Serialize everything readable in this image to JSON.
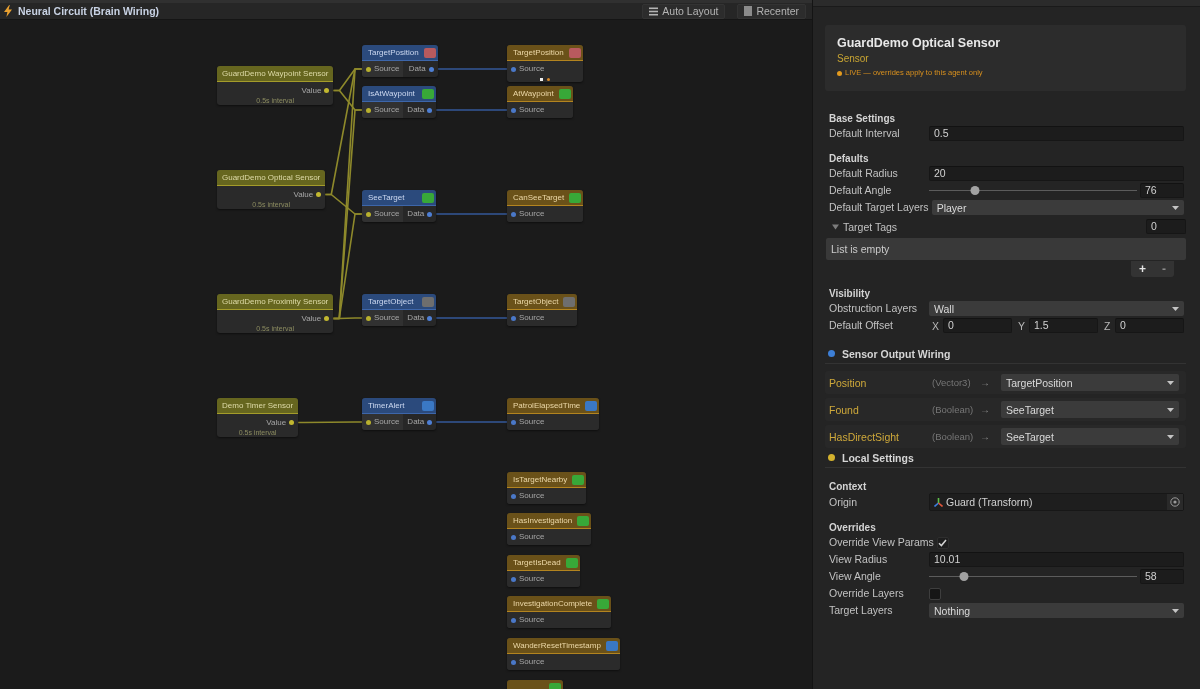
{
  "graph_panel": {
    "title": "Neural Circuit (Brain Wiring)",
    "toolbar": [
      {
        "label": "Auto Layout"
      },
      {
        "label": "Recenter"
      }
    ]
  },
  "graph": {
    "nodes": [
      {
        "kind": "sensor",
        "title": "GuardDemo Waypoint Sensor",
        "outputs": [
          "Value"
        ],
        "note": "0.5s interval"
      },
      {
        "kind": "sensor",
        "title": "GuardDemo Optical Sensor",
        "outputs": [
          "Value"
        ],
        "note": "0.5s interval"
      },
      {
        "kind": "sensor",
        "title": "GuardDemo Proximity Sensor",
        "outputs": [
          "Value"
        ],
        "note": "0.5s interval"
      },
      {
        "kind": "sensor",
        "title": "Demo Timer Sensor",
        "outputs": [
          "Value"
        ],
        "note": "0.5s interval"
      },
      {
        "kind": "data",
        "title": "TargetPosition",
        "badge": {
          "color": "#b85a5e"
        },
        "inputs": [
          "Source"
        ],
        "outputs": [
          "Data"
        ]
      },
      {
        "kind": "data",
        "title": "IsAtWaypoint",
        "badge": {
          "color": "#38a838"
        },
        "inputs": [
          "Source"
        ],
        "outputs": [
          "Data"
        ]
      },
      {
        "kind": "data",
        "title": "SeeTarget",
        "badge": {
          "color": "#38a838"
        },
        "inputs": [
          "Source"
        ],
        "outputs": [
          "Data"
        ]
      },
      {
        "kind": "data",
        "title": "TargetObject",
        "badge": {
          "color": "#6e6e6e"
        },
        "inputs": [
          "Source"
        ],
        "outputs": [
          "Data"
        ]
      },
      {
        "kind": "data",
        "title": "TimerAlert",
        "badge": {
          "color": "#3a78c4"
        },
        "inputs": [
          "Source"
        ],
        "outputs": [
          "Data"
        ]
      },
      {
        "kind": "target",
        "title": "TargetPosition",
        "badge": {
          "color": "#b85a5e"
        },
        "inputs": [
          "Source"
        ],
        "indicators": true
      },
      {
        "kind": "target",
        "title": "AtWaypoint",
        "badge": {
          "color": "#38a838"
        },
        "inputs": [
          "Source"
        ],
        "indicators": false
      },
      {
        "kind": "target",
        "title": "CanSeeTarget",
        "badge": {
          "color": "#38a838"
        },
        "inputs": [
          "Source"
        ],
        "indicators": false
      },
      {
        "kind": "target",
        "title": "TargetObject",
        "badge": {
          "color": "#6e6e6e"
        },
        "inputs": [
          "Source"
        ],
        "indicators": false
      },
      {
        "kind": "target",
        "title": "PatrolElapsedTime",
        "badge": {
          "color": "#3a78c4"
        },
        "inputs": [
          "Source"
        ],
        "indicators": false
      },
      {
        "kind": "target",
        "title": "IsTargetNearby",
        "badge": {
          "color": "#38a838"
        },
        "inputs": [
          "Source"
        ],
        "indicators": false
      },
      {
        "kind": "target",
        "title": "HasInvestigation",
        "badge": {
          "color": "#38a838"
        },
        "inputs": [
          "Source"
        ],
        "indicators": false
      },
      {
        "kind": "target",
        "title": "TargetIsDead",
        "badge": {
          "color": "#38a838"
        },
        "inputs": [
          "Source"
        ],
        "indicators": false
      },
      {
        "kind": "target",
        "title": "InvestigationComplete",
        "badge": {
          "color": "#38a838"
        },
        "inputs": [
          "Source"
        ],
        "indicators": false
      },
      {
        "kind": "target",
        "title": "WanderResetTimestamp",
        "badge": {
          "color": "#3a78c4"
        },
        "inputs": [
          "Source"
        ],
        "indicators": false
      },
      {
        "kind": "target",
        "badge": {
          "color": "#38a838"
        },
        "indicators": false
      }
    ]
  },
  "inspector": {
    "header": {
      "title": "GuardDemo Optical Sensor",
      "subtitle": "Sensor",
      "status": "LIVE — overrides apply to this agent only"
    },
    "sections": [
      {
        "kind": "group",
        "title": "Base Settings",
        "fields": [
          {
            "kind": "number",
            "label": "Default Interval",
            "value": "0.5"
          }
        ]
      },
      {
        "kind": "group",
        "title": "Defaults",
        "fields": [
          {
            "kind": "number",
            "label": "Default Radius",
            "value": "20"
          },
          {
            "kind": "slider",
            "label": "Default Angle",
            "level": 0.22,
            "value": "76"
          },
          {
            "kind": "dropdown",
            "label": "Default Target Layers",
            "value": "Player"
          },
          {
            "kind": "list",
            "label": "Target Tags",
            "expanded": true,
            "count": "0",
            "empty_text": "List is empty",
            "buttons": [
              "+",
              "-"
            ]
          }
        ]
      },
      {
        "kind": "group",
        "title": "Visibility",
        "fields": [
          {
            "kind": "dropdown",
            "label": "Obstruction Layers",
            "value": "Wall"
          },
          {
            "kind": "vector",
            "label": "Default Offset",
            "components": [
              {
                "axis": "X",
                "value": "0"
              },
              {
                "axis": "Y",
                "value": "1.5"
              },
              {
                "axis": "Z",
                "value": "0"
              }
            ]
          }
        ]
      },
      {
        "kind": "heading",
        "title": "Sensor Output Wiring",
        "color": "#3d7fd6"
      },
      {
        "kind": "wiring",
        "rows": [
          {
            "port": "Position",
            "type": "(Vector3)",
            "arrow": "→",
            "target": "TargetPosition"
          },
          {
            "port": "Found",
            "type": "(Boolean)",
            "arrow": "→",
            "target": "SeeTarget"
          },
          {
            "port": "HasDirectSight",
            "type": "(Boolean)",
            "arrow": "→",
            "target": "SeeTarget"
          }
        ]
      },
      {
        "kind": "heading",
        "title": "Local Settings",
        "color": "#d4b22e"
      },
      {
        "kind": "group",
        "title": "Context",
        "fields": [
          {
            "kind": "object",
            "label": "Origin",
            "value": "Guard (Transform)"
          }
        ]
      },
      {
        "kind": "group",
        "title": "Overrides",
        "fields": [
          {
            "kind": "checkbox",
            "label": "Override View Params",
            "checked": true
          },
          {
            "kind": "number",
            "label": "View Radius",
            "value": "10.01"
          },
          {
            "kind": "slider",
            "label": "View Angle",
            "level": 0.17,
            "value": "58"
          },
          {
            "kind": "checkbox",
            "label": "Override Layers",
            "checked": false
          },
          {
            "kind": "dropdown",
            "label": "Target Layers",
            "value": "Nothing"
          }
        ]
      }
    ]
  }
}
